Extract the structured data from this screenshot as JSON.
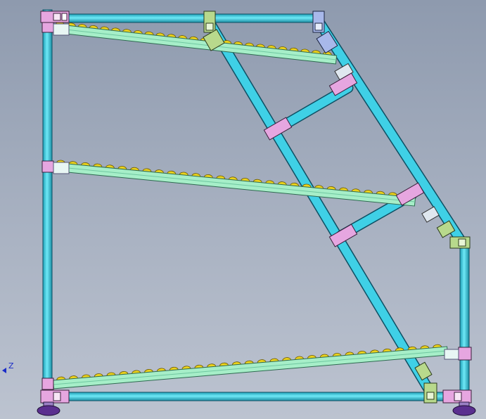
{
  "axis_indicator": {
    "label": "Z",
    "color": "#1a2cc8"
  },
  "colors": {
    "background_top": "#8e9aae",
    "background_bottom": "#bcc3d0",
    "tube_fill": "#3fd0e6",
    "tube_stroke": "#0d4f63",
    "rail_fill": "#a6eec8",
    "rail_stroke": "#2e6a50",
    "roller_fill": "#ecd21c",
    "roller_stroke": "#6b5a05",
    "connector_pink": "#e6a6e0",
    "connector_green": "#b8d98c",
    "connector_blue": "#a8b8ea",
    "foot_fill": "#5a2f8f"
  },
  "icons": [
    "axis-indicator-icon",
    "aluminum-tube",
    "roller-track",
    "pipe-joint",
    "leveling-foot"
  ]
}
